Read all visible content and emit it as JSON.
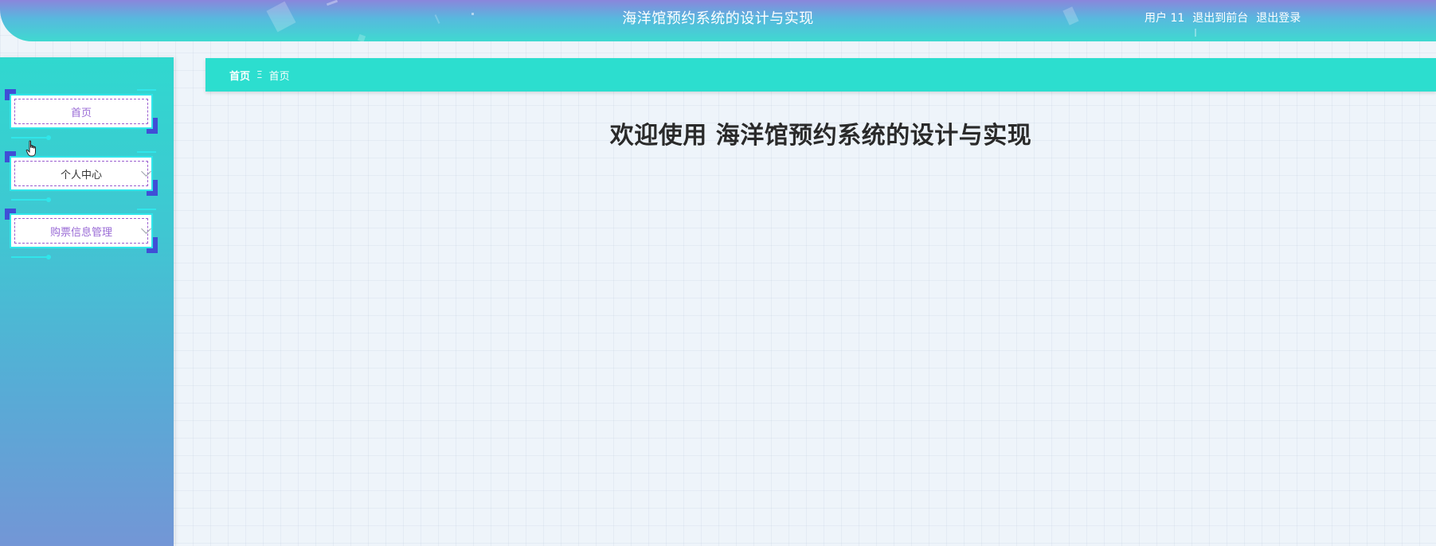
{
  "header": {
    "title": "海洋馆预约系统的设计与实现",
    "user": "用户 11",
    "exit_front": "退出到前台",
    "logout": "退出登录"
  },
  "sidebar": {
    "items": [
      {
        "label": "首页",
        "expandable": false
      },
      {
        "label": "个人中心",
        "expandable": true
      },
      {
        "label": "购票信息管理",
        "expandable": true
      }
    ]
  },
  "breadcrumb": {
    "home": "首页",
    "separator": "Ξ",
    "current": "首页"
  },
  "main": {
    "welcome": "欢迎使用 海洋馆预约系统的设计与实现"
  },
  "colors": {
    "accent": "#2cdecf",
    "menu_text": "#9a6bd6",
    "corner": "#3f4fd6"
  }
}
